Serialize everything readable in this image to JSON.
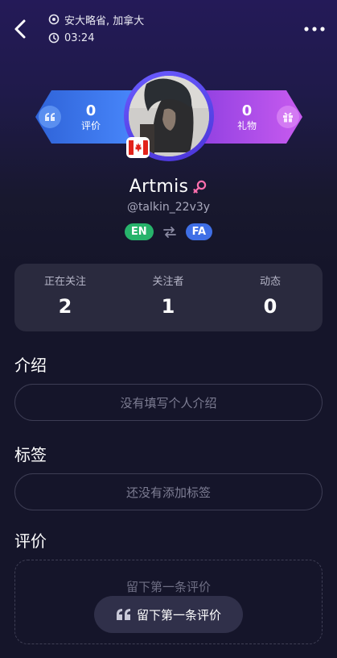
{
  "header": {
    "location": "安大略省, 加拿大",
    "time": "03:24"
  },
  "stats_bar": {
    "reviews_count": "0",
    "reviews_label": "评价",
    "gifts_count": "0",
    "gifts_label": "礼物"
  },
  "profile": {
    "name": "Artmis",
    "handle": "@talkin_22v3y",
    "native_language": "EN",
    "learning_language": "FA"
  },
  "follow": {
    "following_label": "正在关注",
    "following_count": "2",
    "followers_label": "关注者",
    "followers_count": "1",
    "moments_label": "动态",
    "moments_count": "0"
  },
  "intro": {
    "title": "介绍",
    "placeholder": "没有填写个人介绍"
  },
  "tags": {
    "title": "标签",
    "placeholder": "还没有添加标签"
  },
  "reviews": {
    "title": "评价",
    "empty_text": "留下第一条评价",
    "button_label": "留下第一条评价"
  },
  "colors": {
    "background": "#15152a",
    "card": "#2a2a3e",
    "left_pill": "#3b78f0",
    "right_pill": "#b54de6",
    "en_badge": "#27b36b",
    "fa_badge": "#3f6fe6",
    "gender_icon": "#ff6fae"
  },
  "icons": [
    "back-arrow-icon",
    "more-options-icon",
    "location-pin-icon",
    "clock-icon",
    "quote-icon",
    "gift-icon",
    "canada-flag-icon",
    "female-gender-icon",
    "swap-arrows-icon"
  ]
}
